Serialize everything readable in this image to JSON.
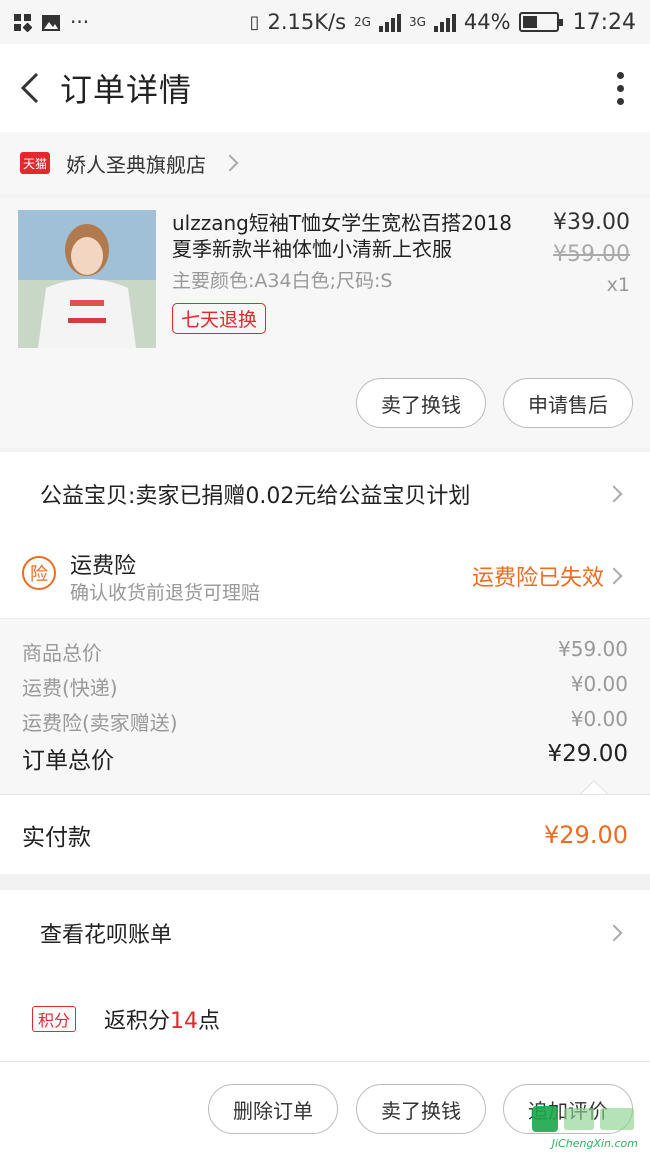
{
  "status_bar": {
    "speed": "2.15K/s",
    "net1": "2G",
    "net2": "3G",
    "battery": "44%",
    "battery_level": 0.44,
    "time": "17:24"
  },
  "header": {
    "title": "订单详情"
  },
  "shop": {
    "badge": "天猫",
    "name": "娇人圣典旗舰店"
  },
  "product": {
    "title": "ulzzang短袖T恤女学生宽松百搭2018夏季新款半袖体恤小清新上衣服",
    "spec": "主要颜色:A34白色;尺码:S",
    "return_tag": "七天退换",
    "price_now": "¥39.00",
    "price_old": "¥59.00",
    "qty": "x1",
    "sell_button": "卖了换钱",
    "aftersale_button": "申请售后"
  },
  "charity": {
    "text": "公益宝贝:卖家已捐赠0.02元给公益宝贝计划"
  },
  "insurance": {
    "icon_text": "险",
    "title": "运费险",
    "subtitle": "确认收货前退货可理赔",
    "status": "运费险已失效"
  },
  "breakdown": {
    "rows": [
      {
        "label": "商品总价",
        "value": "¥59.00"
      },
      {
        "label": "运费(快递)",
        "value": "¥0.00"
      },
      {
        "label": "运费险(卖家赠送)",
        "value": "¥0.00"
      }
    ],
    "total_label": "订单总价",
    "total_value": "¥29.00"
  },
  "paid": {
    "label": "实付款",
    "value": "¥29.00"
  },
  "huabei": {
    "text": "查看花呗账单"
  },
  "points": {
    "badge": "积分",
    "prefix": "返积分",
    "num": "14",
    "suffix": "点"
  },
  "bottom_bar": {
    "delete_button": "删除订单",
    "sell_button": "卖了换钱",
    "review_button": "追加评价"
  },
  "watermark": {
    "text": "JiChengXin.com"
  },
  "colors": {
    "accent_orange": "#f06a22",
    "tmall_red": "#e4282d"
  }
}
